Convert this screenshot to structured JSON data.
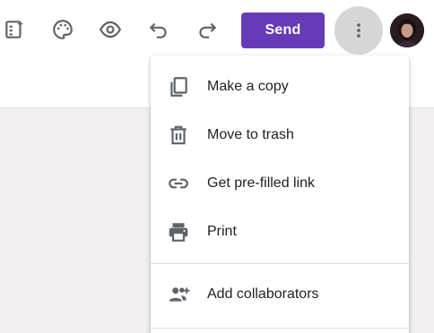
{
  "toolbar": {
    "icons": [
      {
        "name": "customize-form-icon"
      },
      {
        "name": "palette-icon"
      },
      {
        "name": "preview-eye-icon"
      },
      {
        "name": "undo-icon"
      },
      {
        "name": "redo-icon"
      }
    ],
    "send_label": "Send",
    "more_icon": "more-vert-icon",
    "avatar": "user-avatar"
  },
  "menu": {
    "items": [
      {
        "label": "Make a copy",
        "icon": "copy-icon"
      },
      {
        "label": "Move to trash",
        "icon": "trash-icon"
      },
      {
        "label": "Get pre-filled link",
        "icon": "link-icon"
      },
      {
        "label": "Print",
        "icon": "printer-icon"
      },
      {
        "label": "Add collaborators",
        "icon": "add-people-icon"
      }
    ]
  },
  "colors": {
    "accent": "#673ab7",
    "icon_gray": "#5f6368",
    "text": "#202124",
    "canvas": "#f1efef"
  }
}
